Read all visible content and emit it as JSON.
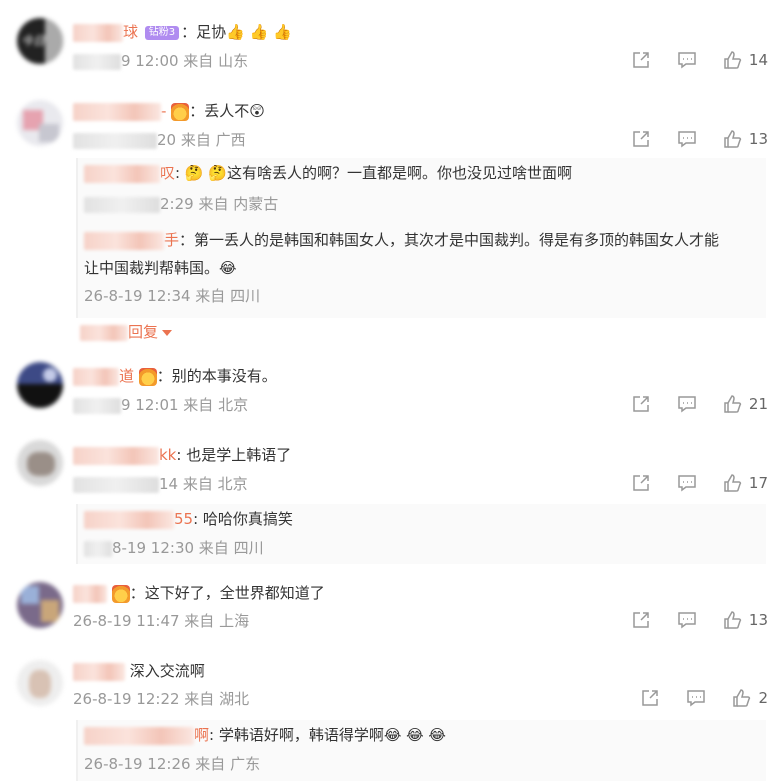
{
  "comments": [
    {
      "name_tail": "球",
      "badge": "钻粉3",
      "text": "：足协👍 👍 👍",
      "meta": "9 12:00 来自 山东",
      "likes": "14",
      "avatar_text": "今日"
    },
    {
      "name_tail": "-",
      "text": "：丢人不😲",
      "meta": "20 来自 广西",
      "likes": "13",
      "replies": [
        {
          "name_tail": "叹",
          "text": ": 🤔 🤔这有啥丢人的啊？一直都是啊。你也没见过啥世面啊",
          "meta": "2:29 来自 内蒙古"
        },
        {
          "name_tail": "手",
          "text": "：第一丢人的是韩国和韩国女人，其次才是中国裁判。得是有多顶的韩国女人才能",
          "text2": "让中国裁判帮韩国。😂",
          "meta": "26-8-19 12:34 来自 四川"
        }
      ],
      "more_label": "回复"
    },
    {
      "name_tail": "道",
      "text": "：别的本事没有。",
      "meta": "9 12:01 来自 北京",
      "likes": "21"
    },
    {
      "name_tail": "kk",
      "text": ": 也是学上韩语了",
      "meta": "14 来自 北京",
      "likes": "17",
      "replies": [
        {
          "name_tail": "55",
          "text": ": 哈哈你真搞笑",
          "meta": "8-19 12:30 来自 四川"
        }
      ]
    },
    {
      "name_tail": "",
      "text": "：这下好了，全世界都知道了",
      "meta": "26-8-19 11:47 来自 上海",
      "likes": "13"
    },
    {
      "name_tail": "",
      "text": "深入交流啊",
      "meta": "26-8-19 12:22 来自 湖北",
      "likes": "2",
      "replies": [
        {
          "name_tail": "啊",
          "text": ": 学韩语好啊，韩语得学啊😂 😂 😂",
          "meta": "26-8-19 12:26 来自 广东"
        }
      ]
    }
  ],
  "icons": {
    "share": "share-icon",
    "comment": "comment-icon",
    "like": "like-icon"
  },
  "colors": {
    "accent": "#eb7350",
    "meta": "#999999",
    "text": "#333333"
  }
}
